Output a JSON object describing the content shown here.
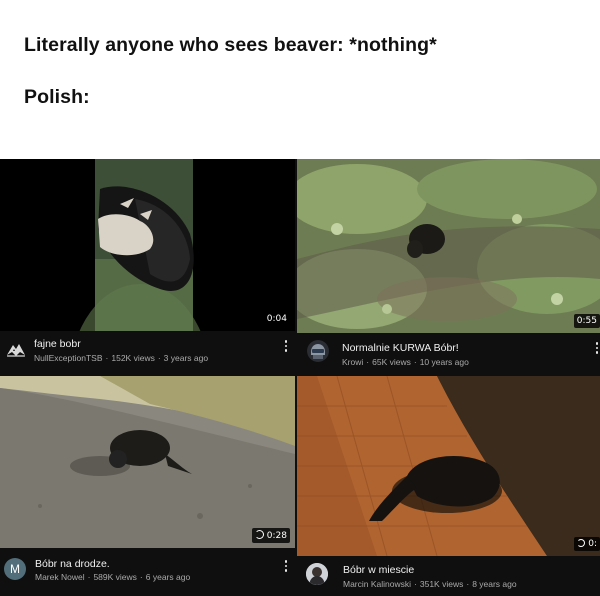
{
  "caption": {
    "line1": "Literally anyone who sees beaver: *nothing*",
    "line2": "Polish:"
  },
  "videos": [
    {
      "title": "fajne bobr",
      "channel": "NullExceptionTSB",
      "views": "152K views",
      "age": "3 years ago",
      "duration": "0:04",
      "avatar_icon": "wolf-logo-icon"
    },
    {
      "title": "Normalnie KURWA Bóbr!",
      "channel": "Krowi",
      "views": "65K views",
      "age": "10 years ago",
      "duration": "0:55",
      "avatar_icon": "helmet-avatar-icon"
    },
    {
      "title": "Bóbr na drodze.",
      "channel": "Marek Nowel",
      "views": "589K views",
      "age": "6 years ago",
      "duration": "0:28",
      "avatar_letter": "M",
      "avatar_color": "#526e7a"
    },
    {
      "title": "Bóbr w miescie",
      "channel": "Marcin Kalinowski",
      "views": "351K views",
      "age": "8 years ago",
      "duration": "0:",
      "avatar_icon": "person-photo-avatar-icon"
    }
  ],
  "colors": {
    "background": "#ffffff",
    "youtube_dark": "#0f0f0f",
    "title_text": "#f1f1f1",
    "meta_text": "#aaaaaa"
  }
}
